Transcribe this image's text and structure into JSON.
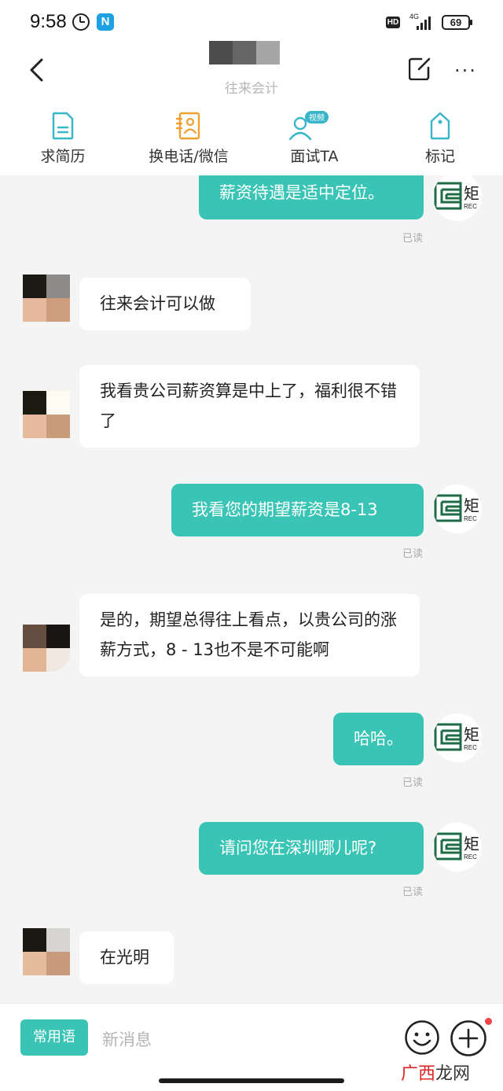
{
  "status_bar": {
    "time": "9:58",
    "app_badge": "N",
    "hd": "HD",
    "network": "4G",
    "battery": "69"
  },
  "header": {
    "subtitle": "往来会计",
    "more_label": "···"
  },
  "toolbar": {
    "items": [
      {
        "label": "求简历",
        "icon": "resume-icon"
      },
      {
        "label": "换电话/微信",
        "icon": "contact-card-icon"
      },
      {
        "label": "面试TA",
        "icon": "interview-icon",
        "badge": "视频"
      },
      {
        "label": "标记",
        "icon": "tag-icon"
      }
    ]
  },
  "messages": [
    {
      "side": "out",
      "text": "薪资待遇是适中定位。",
      "status": "已读"
    },
    {
      "side": "in",
      "text": "往来会计可以做"
    },
    {
      "side": "in",
      "text": "我看贵公司薪资算是中上了，福利很不错了"
    },
    {
      "side": "out",
      "text": "我看您的期望薪资是8-13",
      "status": "已读"
    },
    {
      "side": "in",
      "text": "是的，期望总得往上看点，以贵公司的涨薪方式，8 - 13也不是不可能啊"
    },
    {
      "side": "out",
      "text": "哈哈。",
      "status": "已读"
    },
    {
      "side": "out",
      "text": "请问您在深圳哪儿呢?",
      "status": "已读"
    },
    {
      "side": "in",
      "text": "在光明"
    }
  ],
  "company_logo_text": {
    "main": "矩",
    "sub": "REC"
  },
  "input_bar": {
    "quick_phrases": "常用语",
    "placeholder": "新消息"
  },
  "watermark": {
    "part1": "广西",
    "part2": "龙网"
  },
  "colors": {
    "accent": "#39c4b6",
    "toolbar_icon": "#39b5c9",
    "badge": "#39b5c9",
    "logo": "#1e6b45"
  }
}
